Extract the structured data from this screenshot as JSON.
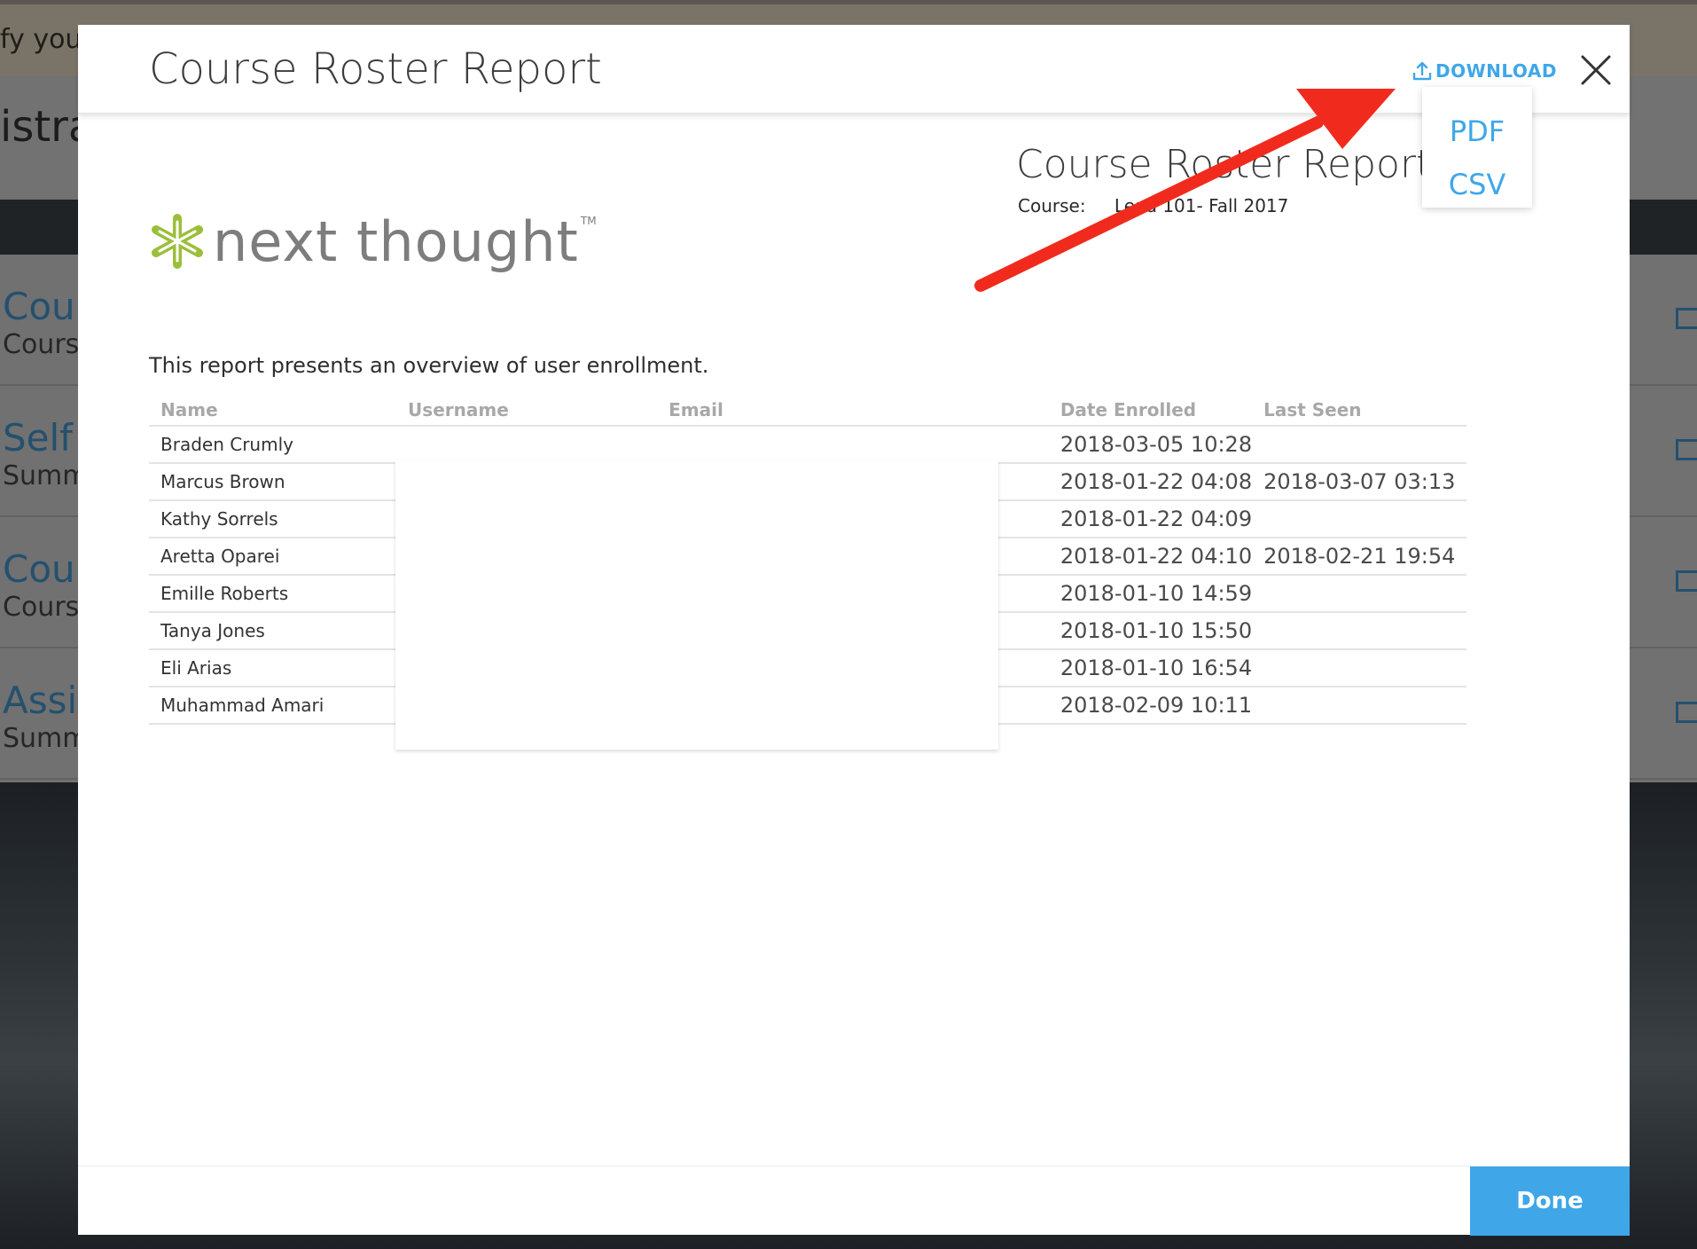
{
  "background": {
    "banner_text": "fy your",
    "header_text": "istra",
    "items": [
      {
        "title": "Cour",
        "subtitle": "Course"
      },
      {
        "title": "Self /",
        "subtitle": "Summ"
      },
      {
        "title": "Cour",
        "subtitle": "Course"
      },
      {
        "title": "Assig",
        "subtitle": "Summ"
      }
    ]
  },
  "modal": {
    "title": "Course Roster Report",
    "download_label": "DOWNLOAD",
    "download_options": [
      "PDF",
      "CSV"
    ],
    "done_label": "Done"
  },
  "report": {
    "title": "Course Roster Report",
    "course_label": "Course:",
    "course_value": "Lead 101- Fall 2017",
    "logo_text": "next thought",
    "logo_tm": "TM",
    "intro": "This report presents an overview of user enrollment.",
    "columns": [
      "Name",
      "Username",
      "Email",
      "Date Enrolled",
      "Last Seen"
    ],
    "rows": [
      {
        "name": "Braden Crumly",
        "enrolled": "2018-03-05 10:28",
        "last_seen": ""
      },
      {
        "name": "Marcus Brown",
        "enrolled": "2018-01-22 04:08",
        "last_seen": "2018-03-07 03:13"
      },
      {
        "name": "Kathy Sorrels",
        "enrolled": "2018-01-22 04:09",
        "last_seen": ""
      },
      {
        "name": "Aretta Oparei",
        "enrolled": "2018-01-22 04:10",
        "last_seen": "2018-02-21 19:54"
      },
      {
        "name": "Emille Roberts",
        "enrolled": "2018-01-10 14:59",
        "last_seen": ""
      },
      {
        "name": "Tanya Jones",
        "enrolled": "2018-01-10 15:50",
        "last_seen": ""
      },
      {
        "name": "Eli Arias",
        "enrolled": "2018-01-10 16:54",
        "last_seen": ""
      },
      {
        "name": "Muhammad Amari",
        "enrolled": "2018-02-09 10:11",
        "last_seen": ""
      }
    ]
  },
  "colors": {
    "accent": "#3fa7e8",
    "annotation_arrow": "#f02b1e",
    "logo_green": "#9bbf3a"
  }
}
